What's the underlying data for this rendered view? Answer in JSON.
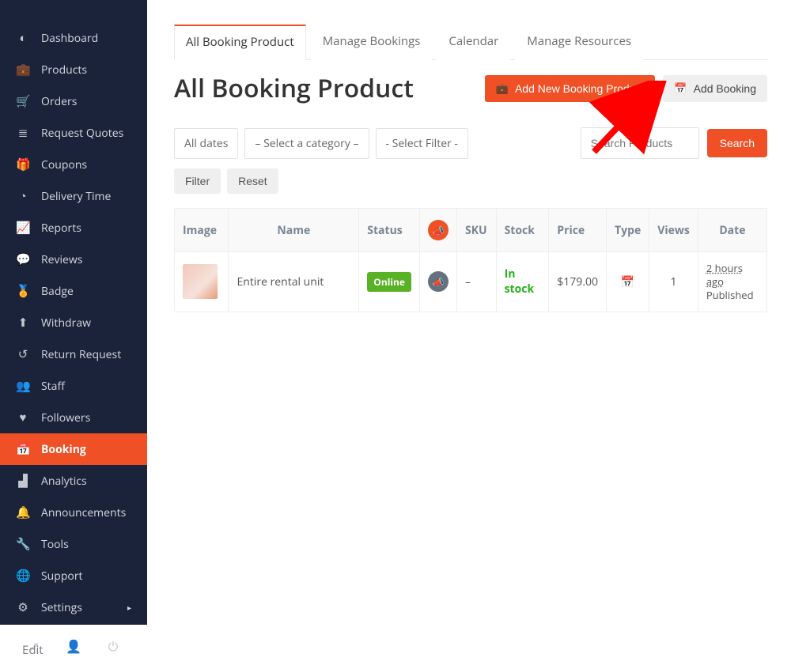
{
  "sidebar": {
    "items": [
      {
        "label": "Dashboard"
      },
      {
        "label": "Products"
      },
      {
        "label": "Orders"
      },
      {
        "label": "Request Quotes"
      },
      {
        "label": "Coupons"
      },
      {
        "label": "Delivery Time"
      },
      {
        "label": "Reports"
      },
      {
        "label": "Reviews"
      },
      {
        "label": "Badge"
      },
      {
        "label": "Withdraw"
      },
      {
        "label": "Return Request"
      },
      {
        "label": "Staff"
      },
      {
        "label": "Followers"
      },
      {
        "label": "Booking"
      },
      {
        "label": "Analytics"
      },
      {
        "label": "Announcements"
      },
      {
        "label": "Tools"
      },
      {
        "label": "Support"
      },
      {
        "label": "Settings"
      }
    ],
    "edit_label": "Edit"
  },
  "tabs": [
    {
      "label": "All Booking Product",
      "active": true
    },
    {
      "label": "Manage Bookings"
    },
    {
      "label": "Calendar"
    },
    {
      "label": "Manage Resources"
    }
  ],
  "page_title": "All Booking Product",
  "header_buttons": {
    "add_new_label": "Add New Booking Product",
    "add_booking_label": "Add Booking"
  },
  "filters": {
    "dates_label": "All dates",
    "category_label": "– Select a category –",
    "filter_type_label": "- Select Filter -",
    "search_placeholder": "Search Products",
    "search_button_label": "Search",
    "filter_button_label": "Filter",
    "reset_button_label": "Reset"
  },
  "table": {
    "columns": {
      "image": "Image",
      "name": "Name",
      "status": "Status",
      "sku": "SKU",
      "stock": "Stock",
      "price": "Price",
      "type": "Type",
      "views": "Views",
      "date": "Date"
    },
    "rows": [
      {
        "name": "Entire rental unit",
        "status": "Online",
        "sku": "–",
        "stock": "In stock",
        "price": "$179.00",
        "views": "1",
        "date_ago": "2 hours ago",
        "date_status": "Published"
      }
    ]
  }
}
